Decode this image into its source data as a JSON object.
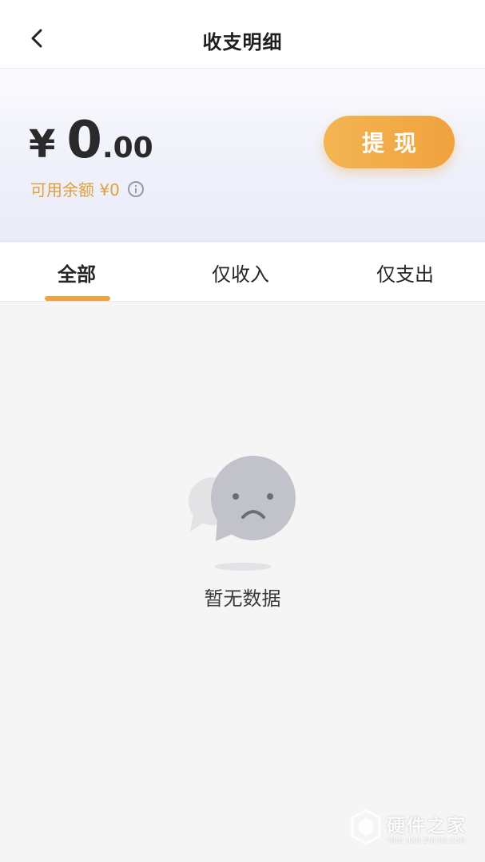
{
  "header": {
    "title": "收支明细",
    "back_icon": "chevron-left-icon"
  },
  "balance": {
    "currency": "¥",
    "amount_int": "0",
    "amount_dec": ".00",
    "available_text": "可用余额 ¥0",
    "info_icon": "info-icon",
    "withdraw_label": "提现",
    "accent": "#f0a23e"
  },
  "tabs": [
    {
      "label": "全部",
      "selected": true
    },
    {
      "label": "仅收入",
      "selected": false
    },
    {
      "label": "仅支出",
      "selected": false
    }
  ],
  "empty_state": {
    "icon": "sad-chat-bubble-icon",
    "text": "暂无数据"
  },
  "watermark": {
    "title": "硬件之家",
    "subtitle": "YING JIAN ZHI JIA.COM"
  }
}
